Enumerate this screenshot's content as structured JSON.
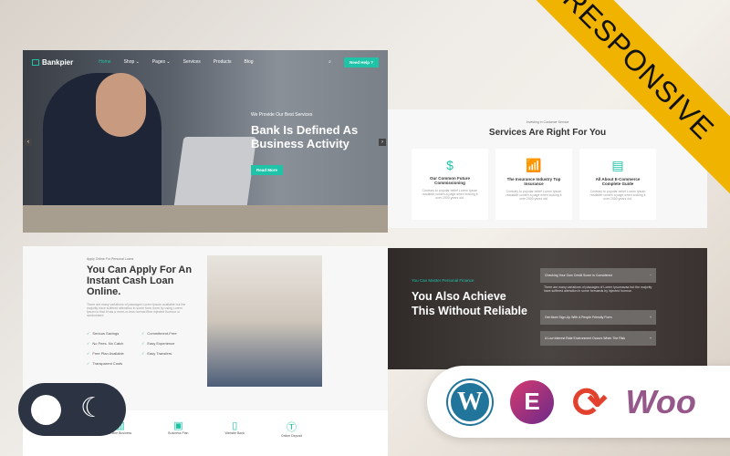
{
  "ribbon": "RESPONSIVE",
  "nav": {
    "brand": "Bankpier",
    "items": [
      "Home",
      "Shop ⌄",
      "Pages ⌄",
      "Services",
      "Products",
      "Blog"
    ],
    "cta": "Need Help ?"
  },
  "hero": {
    "sub": "We Provide Our Best Services",
    "title": "Bank Is Defined As Business Activity",
    "button": "Read More"
  },
  "services": {
    "kicker": "Investing In Customer Service",
    "title": "Services Are Right For You",
    "cards": [
      {
        "icon": "dollar-cycle-icon",
        "title": "Our Common Future Commissioning",
        "desc": "Contrary to popular belief Lorem Ipsum readable conten a page when looking it over 2000 years old."
      },
      {
        "icon": "growth-chart-icon",
        "title": "The Insurance Industry Top Insurance",
        "desc": "Contrary to popular belief Lorem Ipsum readable conten a page when looking it over 2000 years old."
      },
      {
        "icon": "document-icon",
        "title": "All About E-Commerce Complete Guide",
        "desc": "Contrary to popular belief Lorem Ipsum readable conten a page when looking it over 2000 years old."
      }
    ]
  },
  "loan": {
    "kicker": "Apply Online For Personal Loans",
    "title": "You Can Apply For An Instant Cash Loan Online.",
    "desc": "There are many variations of passages Lorem Ipsum available but the majority have suffered alteration in some form more by using Lorem Ipsum is that it has a more-or-less normal fibre injected humour or randomised.",
    "features": [
      "Serious Savings",
      "Commitment-Free",
      "No Fees. No Catch",
      "Easy Experience",
      "Free Plan Available",
      "Easy Transfers",
      "Transparent Costs"
    ]
  },
  "bottom_items": [
    "Online Business",
    "Business Plan",
    "Website Bank",
    "Online Deposit"
  ],
  "achieve": {
    "kicker": "You Can Master Personal Finance",
    "title": "You Also Achieve This Without Reliable",
    "accordion": [
      "Checking Your Own Credit Score Is Considered",
      "Get More Sign-Up With A People Friendly Form",
      "A Low Interest Rate Environment Occurs When The Risk"
    ],
    "answer": "There are many variations of passages of Lorem Ipsumavaa but the majority have suffered alteration in some formaeds by injected humour."
  },
  "colors": {
    "accent": "#1ec3a8",
    "ribbon": "#f0b400",
    "toggle": "#2c3444"
  }
}
